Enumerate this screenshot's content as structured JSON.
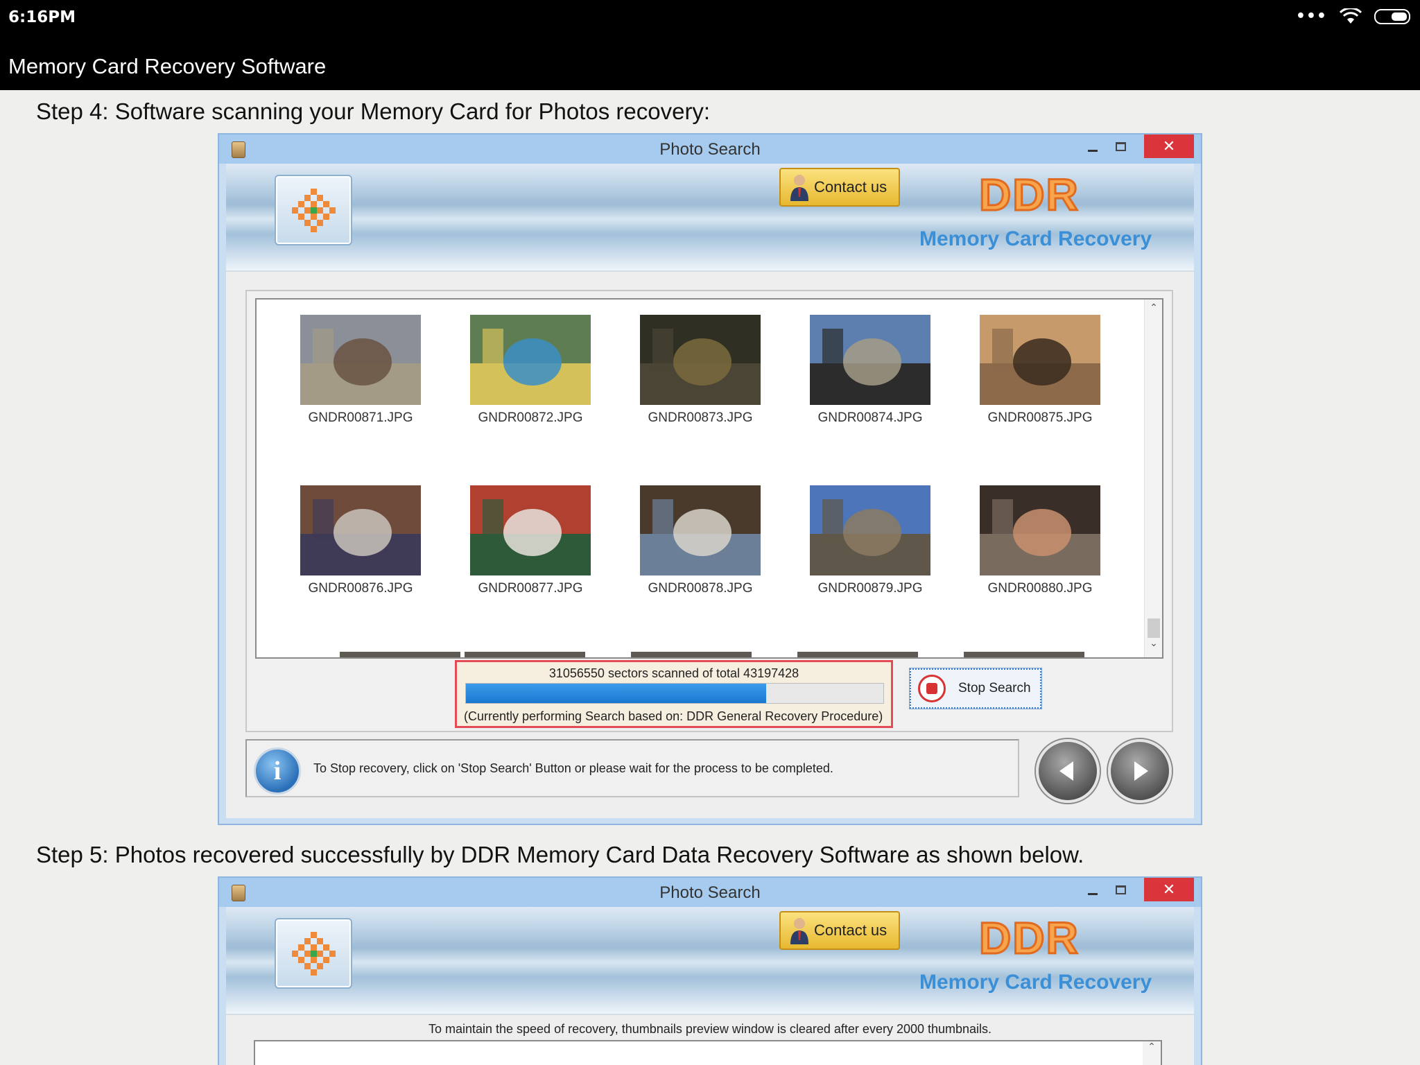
{
  "status_bar": {
    "time": "6:16PM",
    "overflow_icon": "more-dots-icon",
    "wifi_icon": "wifi-icon",
    "battery_icon": "battery-icon"
  },
  "action_bar": {
    "title": "Memory Card Recovery Software"
  },
  "step4": {
    "text": "Step 4: Software scanning your Memory Card for Photos recovery:"
  },
  "step5": {
    "text": "Step 5: Photos recovered successfully by DDR Memory Card Data Recovery Software as shown below."
  },
  "window1": {
    "title": "Photo Search",
    "close": "✕",
    "contact_label": "Contact us",
    "logo_text": "DDR",
    "logo_subtitle": "Memory Card Recovery",
    "thumbnails": [
      {
        "name": "GNDR00871.JPG",
        "colors": [
          "#8b8f98",
          "#6a5442",
          "#a39b86"
        ]
      },
      {
        "name": "GNDR00872.JPG",
        "colors": [
          "#5f7d52",
          "#3b8ec6",
          "#d4c15a"
        ]
      },
      {
        "name": "GNDR00873.JPG",
        "colors": [
          "#2f2f24",
          "#7a6a3c",
          "#4a4535"
        ]
      },
      {
        "name": "GNDR00874.JPG",
        "colors": [
          "#5c7fb0",
          "#a49b86",
          "#2c2c2c"
        ]
      },
      {
        "name": "GNDR00875.JPG",
        "colors": [
          "#c79a6b",
          "#3a2a1f",
          "#8c6a4a"
        ]
      },
      {
        "name": "GNDR00876.JPG",
        "colors": [
          "#6e4b3a",
          "#c9c3bd",
          "#3f3a55"
        ]
      },
      {
        "name": "GNDR00877.JPG",
        "colors": [
          "#b04030",
          "#e8e3dd",
          "#2f5a3a"
        ]
      },
      {
        "name": "GNDR00878.JPG",
        "colors": [
          "#4a3a2c",
          "#d8d3cb",
          "#6b7f99"
        ]
      },
      {
        "name": "GNDR00879.JPG",
        "colors": [
          "#4c76b9",
          "#8c7a62",
          "#5f5749"
        ]
      },
      {
        "name": "GNDR00880.JPG",
        "colors": [
          "#3a2e28",
          "#c98f6e",
          "#7a6b5f"
        ]
      }
    ],
    "progress_text": "31056550 sectors scanned of total 43197428",
    "progress_fraction": 0.719,
    "progress_note": "(Currently performing Search based on:  DDR General Recovery Procedure)",
    "stop_label": "Stop Search",
    "info_text": "To Stop recovery, click on 'Stop Search' Button or please wait for the process to be completed."
  },
  "window2": {
    "title": "Photo Search",
    "close": "✕",
    "contact_label": "Contact us",
    "logo_text": "DDR",
    "logo_subtitle": "Memory Card Recovery",
    "notice": "To maintain the speed of recovery, thumbnails preview window is cleared after every 2000 thumbnails."
  },
  "colors": {
    "accent_blue": "#1a79d0",
    "progress_border": "#e54b55",
    "ddr_orange": "#f7a44c",
    "ddr_subtitle": "#3b8fd6",
    "close_red": "#d9353a"
  }
}
